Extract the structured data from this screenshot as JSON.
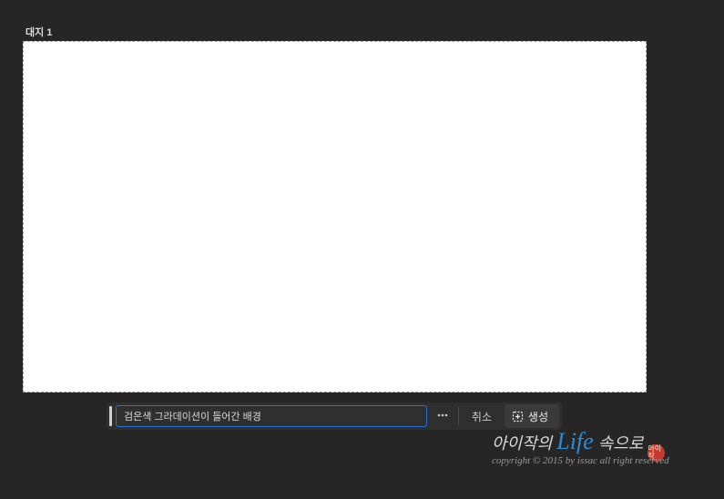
{
  "artboard": {
    "label": "대지 1"
  },
  "promptBar": {
    "inputValue": "검은색 그라데이션이 들어간 배경",
    "cancelLabel": "취소",
    "generateLabel": "생성"
  },
  "signature": {
    "part1": "아이작의",
    "part2": "Life",
    "part3": "속으로",
    "sealText": "아이작"
  },
  "copyright": {
    "text": "copyright © 2015 by issac all right reserved"
  }
}
